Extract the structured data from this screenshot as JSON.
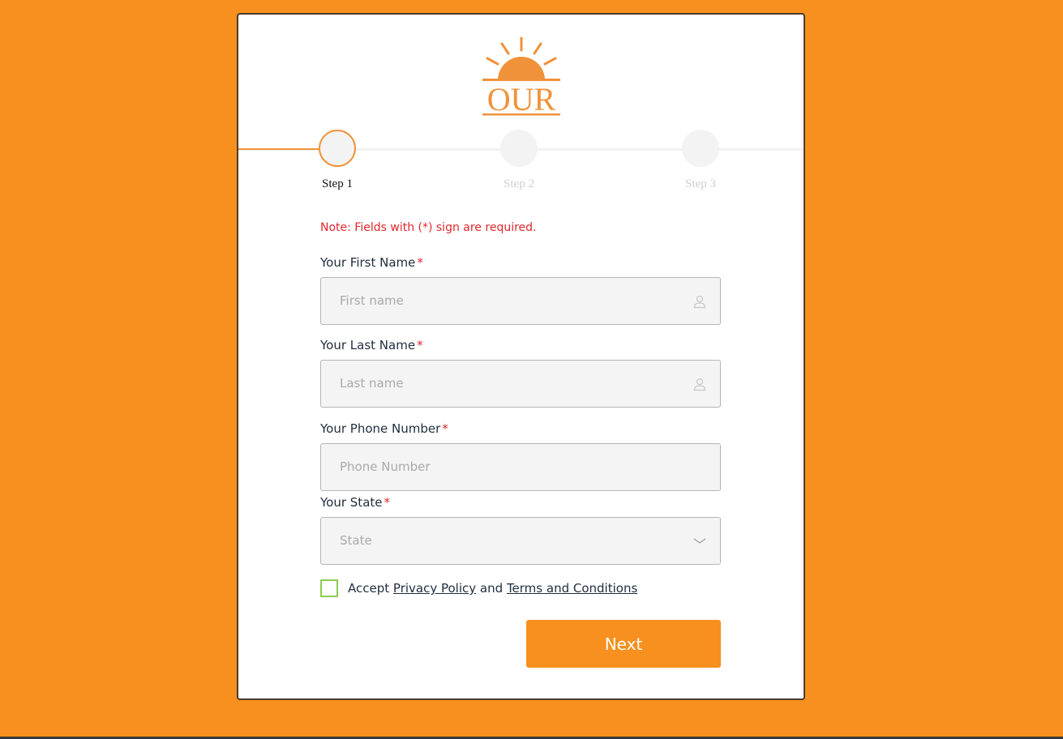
{
  "brand": {
    "logo_text": "OUR",
    "accent_color": "#f7901e"
  },
  "stepper": {
    "steps": [
      {
        "label": "Step 1",
        "state": "active"
      },
      {
        "label": "Step 2",
        "state": "inactive"
      },
      {
        "label": "Step 3",
        "state": "inactive"
      }
    ]
  },
  "form": {
    "note": "Note: Fields with (*) sign are required.",
    "required_marker": "*",
    "first_name": {
      "label": "Your First Name",
      "placeholder": "First name",
      "value": "",
      "icon": "user-icon"
    },
    "last_name": {
      "label": "Your Last Name",
      "placeholder": "Last name",
      "value": "",
      "icon": "user-icon"
    },
    "phone": {
      "label": "Your Phone Number",
      "placeholder": "Phone Number",
      "value": ""
    },
    "state": {
      "label": "Your State",
      "placeholder": "State",
      "icon": "chevron-down-icon"
    },
    "accept": {
      "checked": false,
      "prefix": "Accept",
      "privacy_link": "Privacy Policy",
      "conjunction": "and",
      "terms_link": "Terms and Conditions"
    },
    "next_label": "Next"
  }
}
